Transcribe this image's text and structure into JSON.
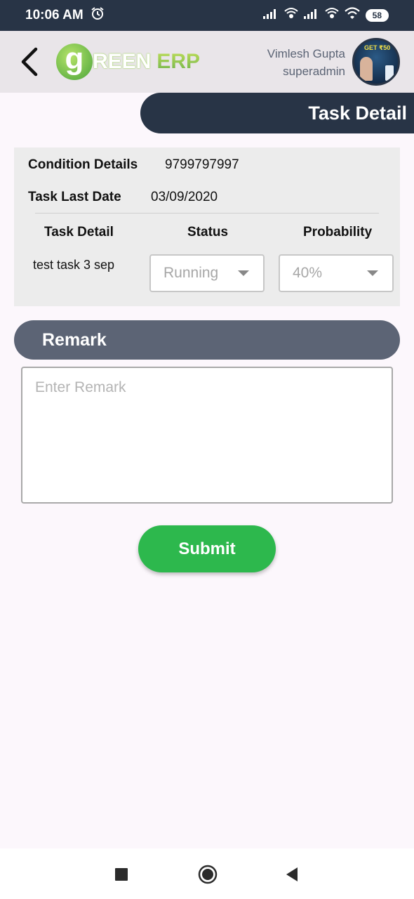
{
  "status_bar": {
    "time": "10:06 AM",
    "battery": "58"
  },
  "header": {
    "logo": {
      "letter": "g",
      "reen": "REEN",
      "erp": "ERP"
    },
    "user_name": "Vimlesh Gupta",
    "user_role": "superadmin",
    "avatar_promo": "GET ₹50"
  },
  "page_title": "Task Detail",
  "details": {
    "condition_label": "Condition Details",
    "condition_value": "9799797997",
    "last_date_label": "Task Last Date",
    "last_date_value": "03/09/2020",
    "columns": [
      "Task Detail",
      "Status",
      "Probability"
    ],
    "task_name": "test task 3 sep",
    "status_value": "Running",
    "probability_value": "40%"
  },
  "remark": {
    "title": "Remark",
    "placeholder": "Enter Remark"
  },
  "submit_label": "Submit",
  "colors": {
    "header_dark": "#283446",
    "accent_green": "#2db84d",
    "remark_bar": "#5c6475"
  }
}
